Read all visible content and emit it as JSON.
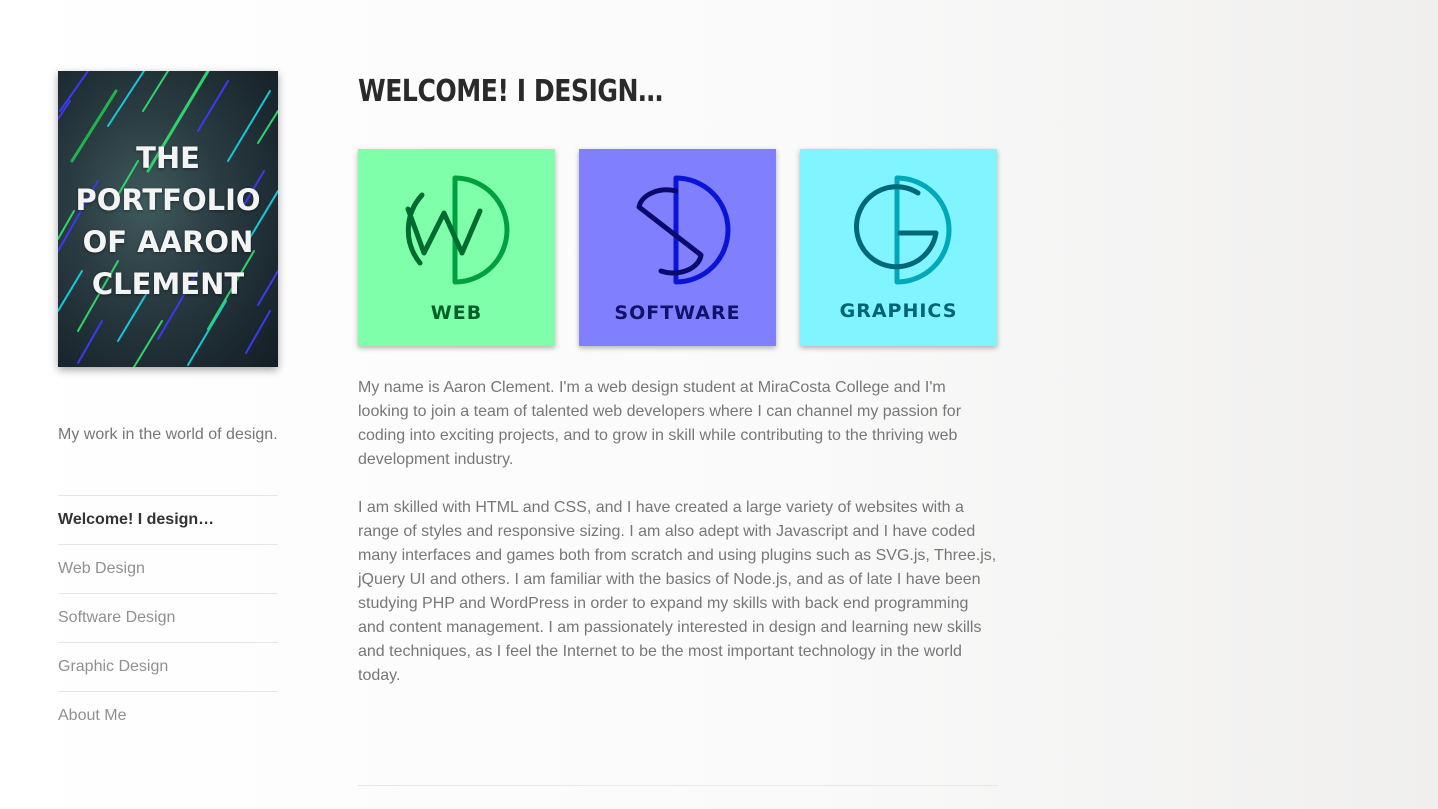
{
  "sidebar": {
    "logo_lines": [
      "THE",
      "PORTFOLIO",
      "OF AARON",
      "CLEMENT"
    ],
    "tagline": "My work in the world of design.",
    "nav": [
      {
        "label": "Welcome! I design…",
        "active": true
      },
      {
        "label": "Web Design",
        "active": false
      },
      {
        "label": "Software Design",
        "active": false
      },
      {
        "label": "Graphic Design",
        "active": false
      },
      {
        "label": "About Me",
        "active": false
      }
    ]
  },
  "main": {
    "heading": "WELCOME! I DESIGN…",
    "cards": [
      {
        "label": "WEB",
        "bg": "#80ffaa",
        "fg": "#00a03e",
        "dark": "#006b2e",
        "text": "#00602a",
        "icon": "web-logo-icon"
      },
      {
        "label": "SOFTWARE",
        "bg": "#8080ff",
        "fg": "#0a14d6",
        "dark": "#0a0a6e",
        "text": "#12126b",
        "icon": "software-logo-icon"
      },
      {
        "label": "GRAPHICS",
        "bg": "#80f4ff",
        "fg": "#00a8b8",
        "dark": "#006878",
        "text": "#006470",
        "icon": "graphics-logo-icon"
      }
    ],
    "paragraphs": [
      "My name is Aaron Clement. I'm a web design student at MiraCosta College and I'm looking to join a team of talented web developers where I can channel my passion for coding into exciting projects, and to grow in skill while contributing to the thriving web development industry.",
      "I am skilled with HTML and CSS, and I have created a large variety of websites with a range of styles and responsive sizing. I am also adept with Javascript and I have coded many interfaces and games both from scratch and using plugins such as SVG.js, Three.js, jQuery UI and others. I am familiar with the basics of Node.js, and as of late I have been studying PHP and WordPress in order to expand my skills with back end programming and content management. I am passionately interested in design and learning new skills and techniques, as I feel the Internet to be the most important technology in the world today."
    ]
  },
  "colors": {
    "accent_green": "#2ed46a",
    "accent_blue": "#3a3af0",
    "accent_cyan": "#19c6d6"
  }
}
